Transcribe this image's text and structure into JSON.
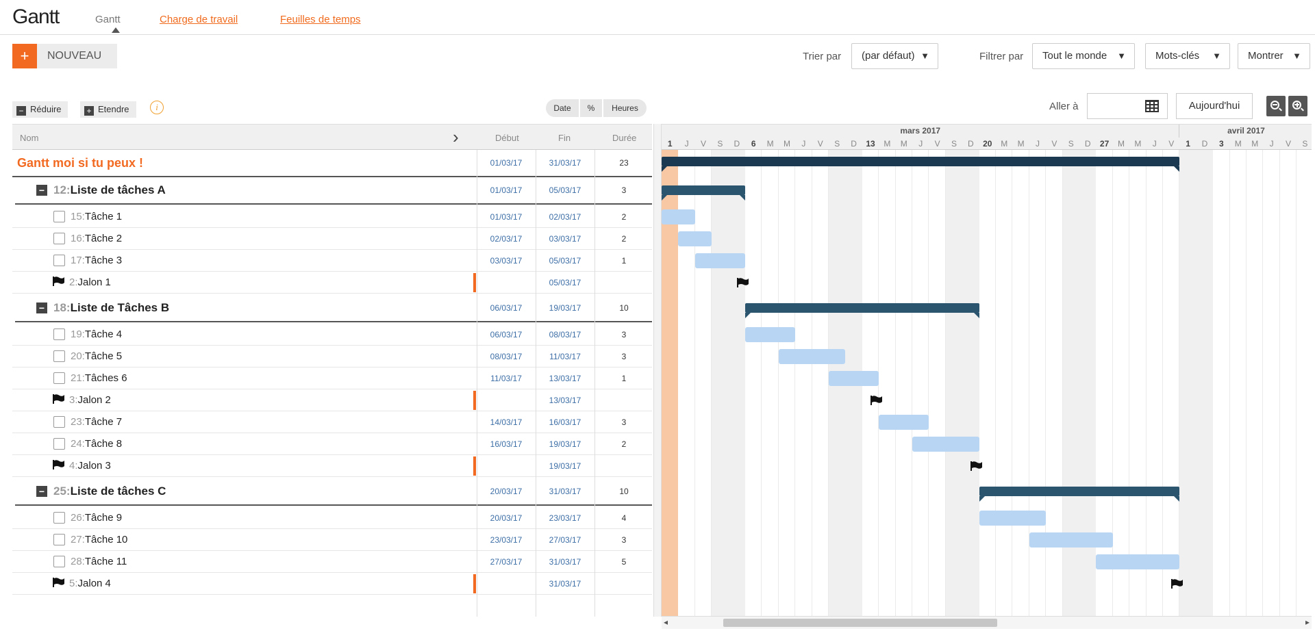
{
  "app": {
    "title": "Gantt"
  },
  "nav": {
    "active": "Gantt",
    "links": [
      "Charge de travail",
      "Feuilles de temps"
    ]
  },
  "toolbar": {
    "new_plus": "+",
    "new_label": "NOUVEAU",
    "sort_label": "Trier par",
    "sort_value": "(par défaut)",
    "filter_label": "Filtrer par",
    "filter_value": "Tout le monde",
    "keywords_value": "Mots-clés",
    "show_value": "Montrer",
    "caret": "▼"
  },
  "grid_toolbar": {
    "collapse_label": "Réduire",
    "expand_label": "Etendre",
    "collapse_icon": "−",
    "expand_icon": "+",
    "info_icon": "i",
    "modes": [
      "Date",
      "%",
      "Heures"
    ],
    "goto_label": "Aller à",
    "today_label": "Aujourd'hui"
  },
  "columns": {
    "name": "Nom",
    "start": "Début",
    "end": "Fin",
    "duration": "Durée",
    "expand_icon": "›"
  },
  "project": {
    "name": "Gantt moi si tu peux !",
    "start": "01/03/17",
    "end": "31/03/17",
    "duration": "23",
    "bar_start": "01/03/17",
    "bar_end": "31/03/17"
  },
  "rows": [
    {
      "kind": "list",
      "id": "12:",
      "name": "Liste de tâches A",
      "start": "01/03/17",
      "end": "05/03/17",
      "duration": "3"
    },
    {
      "kind": "task",
      "id": "15:",
      "name": "Tâche 1",
      "start": "01/03/17",
      "end": "02/03/17",
      "duration": "2"
    },
    {
      "kind": "task",
      "id": "16:",
      "name": "Tâche 2",
      "start": "02/03/17",
      "end": "03/03/17",
      "duration": "2"
    },
    {
      "kind": "task",
      "id": "17:",
      "name": "Tâche 3",
      "start": "03/03/17",
      "end": "05/03/17",
      "duration": "1"
    },
    {
      "kind": "milestone",
      "id": "2:",
      "name": "Jalon 1",
      "start": "",
      "end": "05/03/17",
      "duration": ""
    },
    {
      "kind": "list",
      "id": "18:",
      "name": "Liste de Tâches B",
      "start": "06/03/17",
      "end": "19/03/17",
      "duration": "10"
    },
    {
      "kind": "task",
      "id": "19:",
      "name": "Tâche 4",
      "start": "06/03/17",
      "end": "08/03/17",
      "duration": "3"
    },
    {
      "kind": "task",
      "id": "20:",
      "name": "Tâche 5",
      "start": "08/03/17",
      "end": "11/03/17",
      "duration": "3"
    },
    {
      "kind": "task",
      "id": "21:",
      "name": "Tâches 6",
      "start": "11/03/17",
      "end": "13/03/17",
      "duration": "1"
    },
    {
      "kind": "milestone",
      "id": "3:",
      "name": "Jalon 2",
      "start": "",
      "end": "13/03/17",
      "duration": ""
    },
    {
      "kind": "task",
      "id": "23:",
      "name": "Tâche 7",
      "start": "14/03/17",
      "end": "16/03/17",
      "duration": "3"
    },
    {
      "kind": "task",
      "id": "24:",
      "name": "Tâche 8",
      "start": "16/03/17",
      "end": "19/03/17",
      "duration": "2"
    },
    {
      "kind": "milestone",
      "id": "4:",
      "name": "Jalon 3",
      "start": "",
      "end": "19/03/17",
      "duration": ""
    },
    {
      "kind": "list",
      "id": "25:",
      "name": "Liste de tâches C",
      "start": "20/03/17",
      "end": "31/03/17",
      "duration": "10"
    },
    {
      "kind": "task",
      "id": "26:",
      "name": "Tâche 9",
      "start": "20/03/17",
      "end": "23/03/17",
      "duration": "4"
    },
    {
      "kind": "task",
      "id": "27:",
      "name": "Tâche 10",
      "start": "23/03/17",
      "end": "27/03/17",
      "duration": "3"
    },
    {
      "kind": "task",
      "id": "28:",
      "name": "Tâche 11",
      "start": "27/03/17",
      "end": "31/03/17",
      "duration": "5"
    },
    {
      "kind": "milestone",
      "id": "5:",
      "name": "Jalon 4",
      "start": "",
      "end": "31/03/17",
      "duration": ""
    }
  ],
  "timeline": {
    "months": [
      {
        "label": "mars 2017",
        "days": 31
      },
      {
        "label": "avril 2017",
        "days": 8
      }
    ],
    "days": [
      "1",
      "J",
      "V",
      "S",
      "D",
      "6",
      "M",
      "M",
      "J",
      "V",
      "S",
      "D",
      "13",
      "M",
      "M",
      "J",
      "V",
      "S",
      "D",
      "20",
      "M",
      "M",
      "J",
      "V",
      "S",
      "D",
      "27",
      "M",
      "M",
      "J",
      "V",
      "1",
      "D",
      "3",
      "M",
      "M",
      "J",
      "V",
      "S"
    ],
    "today": "01/03/17",
    "weekend_days": [
      "04/03",
      "05/03",
      "11/03",
      "12/03",
      "18/03",
      "19/03",
      "25/03",
      "26/03",
      "01/04",
      "02/04"
    ],
    "colors": {
      "today": "#f8c7a4",
      "weekend": "#f0f0f0",
      "list_bar": "#2b546e",
      "project_bar": "#1b3a52",
      "task_bar": "#b8d6f3",
      "accent": "#f26a21",
      "date_text": "#3c6ea6"
    }
  },
  "scroll": {
    "left_arrow": "◂",
    "right_arrow": "▸"
  }
}
